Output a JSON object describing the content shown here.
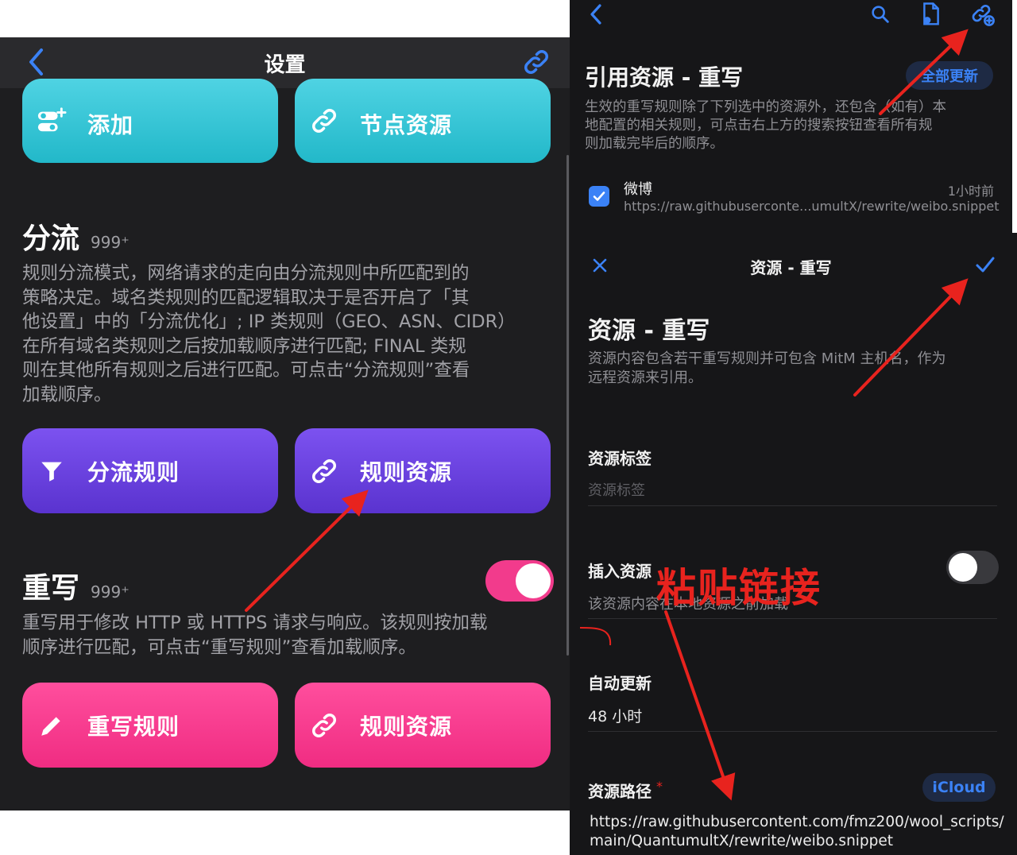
{
  "left": {
    "nav": {
      "title": "设置"
    },
    "top_buttons": [
      {
        "label": "添加",
        "icon": "add-toggle-icon"
      },
      {
        "label": "节点资源",
        "icon": "link-icon"
      }
    ],
    "split": {
      "title": "分流",
      "badge": "999⁺",
      "desc": [
        "规则分流模式，网络请求的走向由分流规则中所匹配到的",
        "策略决定。域名类规则的匹配逻辑取决于是否开启了「其",
        "他设置」中的「分流优化」; IP 类规则（GEO、ASN、CIDR）",
        "在所有域名类规则之后按加载顺序进行匹配; FINAL 类规",
        "则在其他所有规则之后进行匹配。可点击“分流规则”查看",
        "加载顺序。"
      ],
      "buttons": [
        {
          "label": "分流规则",
          "icon": "filter-icon"
        },
        {
          "label": "规则资源",
          "icon": "link-icon"
        }
      ]
    },
    "rewrite": {
      "title": "重写",
      "badge": "999⁺",
      "toggle_on": true,
      "desc": [
        "重写用于修改 HTTP 或 HTTPS 请求与响应。该规则按加载",
        "顺序进行匹配，可点击“重写规则”查看加载顺序。"
      ],
      "buttons": [
        {
          "label": "重写规则",
          "icon": "pencil-icon"
        },
        {
          "label": "规则资源",
          "icon": "link-icon"
        }
      ]
    }
  },
  "right_top": {
    "title": "引用资源 - 重写",
    "update_all": "全部更新",
    "desc": [
      "生效的重写规则除了下列选中的资源外，还包含（如有）本",
      "地配置的相关规则，可点击右上方的搜索按钮查看所有规",
      "则加载完毕后的顺序。"
    ],
    "item": {
      "name": "微博",
      "time": "1小时前",
      "url": "https://raw.githubuserconte...umultX/rewrite/weibo.snippet",
      "checked": true
    }
  },
  "right_bottom": {
    "nav_title": "资源 - 重写",
    "title": "资源 - 重写",
    "desc": [
      "资源内容包含若干重写规则并可包含 MitM 主机名，作为",
      "远程资源来引用。"
    ],
    "tag": {
      "label": "资源标签",
      "placeholder": "资源标签"
    },
    "insert": {
      "label": "插入资源",
      "sub": "该资源内容在本地资源之前加载",
      "toggle_on": false
    },
    "auto_update": {
      "label": "自动更新",
      "value": "48 小时"
    },
    "path": {
      "label": "资源路径",
      "required": "*",
      "icloud": "iCloud",
      "value": [
        "https://raw.githubusercontent.com/fmz200/wool_scripts/",
        "main/QuantumultX/rewrite/weibo.snippet"
      ]
    }
  },
  "annotation": {
    "text": "粘贴链接",
    "color": "#e8231e"
  },
  "colors": {
    "accent_blue": "#3b82f6",
    "cyan": "#2ec4d6",
    "purple": "#6a3fe0",
    "pink": "#f73a8e",
    "arrow_red": "#e8231e"
  }
}
